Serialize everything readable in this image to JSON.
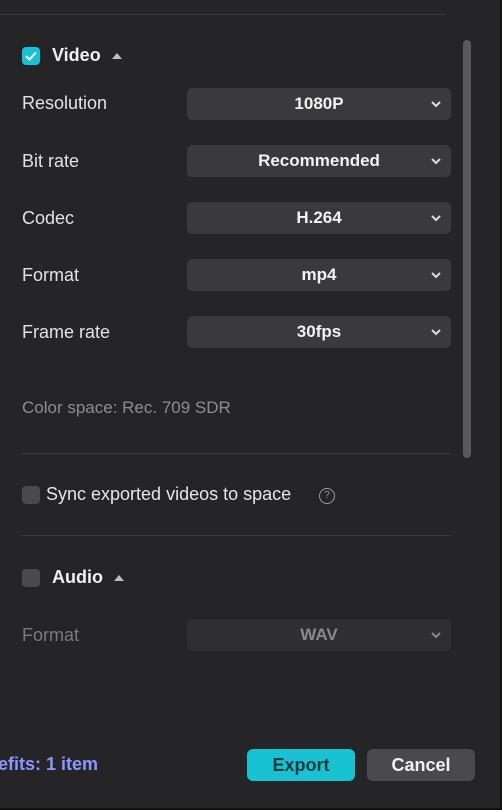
{
  "video": {
    "title": "Video",
    "checked": true,
    "rows": [
      {
        "label": "Resolution",
        "value": "1080P"
      },
      {
        "label": "Bit rate",
        "value": "Recommended"
      },
      {
        "label": "Codec",
        "value": "H.264"
      },
      {
        "label": "Format",
        "value": "mp4"
      },
      {
        "label": "Frame rate",
        "value": "30fps"
      }
    ],
    "color_space": "Color space: Rec. 709 SDR"
  },
  "sync": {
    "label": "Sync exported videos to space",
    "checked": false,
    "help_icon": "?"
  },
  "audio": {
    "title": "Audio",
    "checked": false,
    "rows": [
      {
        "label": "Format",
        "value": "WAV"
      }
    ]
  },
  "footer": {
    "benefits": "efits: 1 item",
    "export_label": "Export",
    "cancel_label": "Cancel"
  },
  "colors": {
    "accent": "#19c2d2",
    "benefits": "#8f95ff",
    "panel": "#252527"
  },
  "icons": [
    "check-icon",
    "caret-up-icon",
    "chevron-down-icon",
    "help-icon"
  ]
}
